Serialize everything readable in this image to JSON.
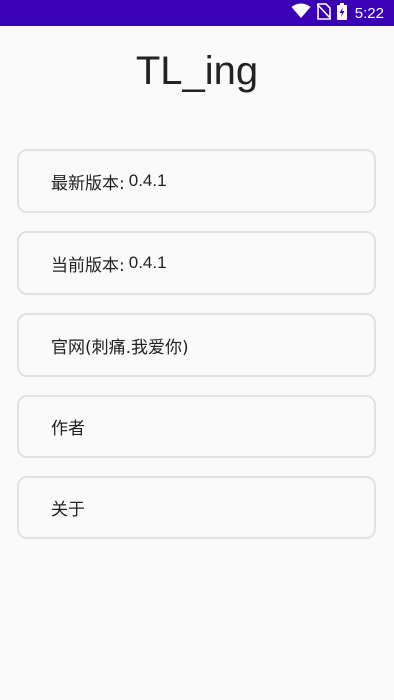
{
  "status_bar": {
    "time": "5:22",
    "background": "#3a00b5",
    "icons": [
      "wifi-icon",
      "no-sim-icon",
      "battery-charging-icon"
    ]
  },
  "app": {
    "title": "TL_ing"
  },
  "menu": {
    "latest_version_label": "最新版本:",
    "latest_version_value": "0.4.1",
    "current_version_label": "当前版本:",
    "current_version_value": "0.4.1",
    "website_label": "官网(刺痛.我爱你)",
    "author_label": "作者",
    "about_label": "关于"
  }
}
